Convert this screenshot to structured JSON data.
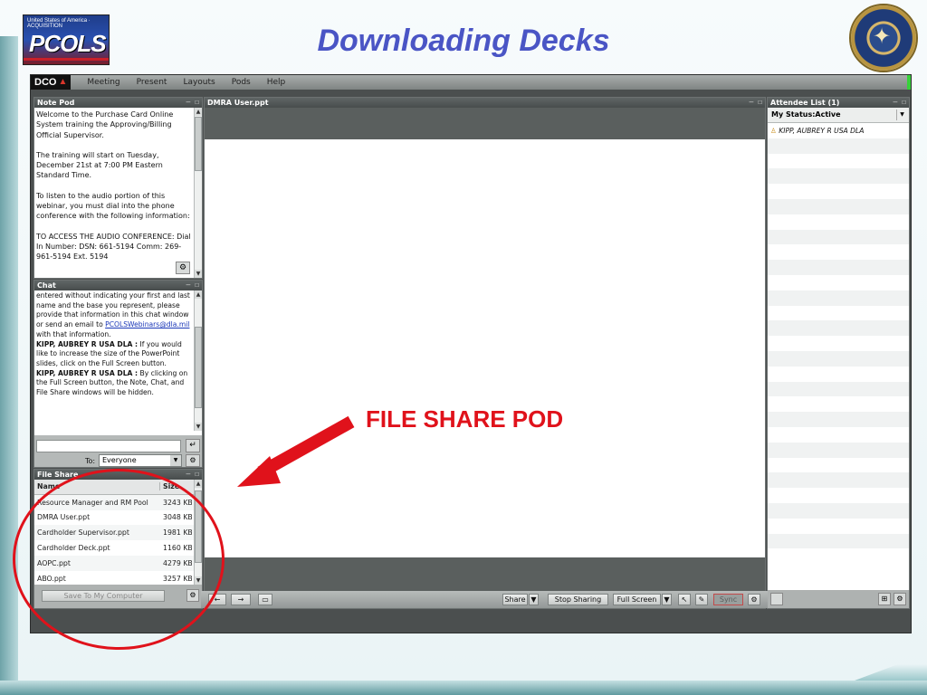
{
  "slide": {
    "title": "Downloading Decks",
    "logo_text": "PCOLS",
    "logo_small": "United States of America · ACQUISITION",
    "callout": "FILE SHARE POD",
    "seal_icon": "dod-seal-icon"
  },
  "app": {
    "brand": "DCO",
    "menu": [
      "Meeting",
      "Present",
      "Layouts",
      "Pods",
      "Help"
    ],
    "pods": {
      "note": {
        "title": "Note Pod",
        "paragraphs": [
          "Welcome to the Purchase Card Online System training the Approving/Billing Official Supervisor.",
          "The training will start on Tuesday, December 21st at 7:00 PM Eastern Standard Time.",
          "To listen to the audio portion of this webinar, you must dial into the phone conference with the following information:",
          "TO ACCESS THE AUDIO CONFERENCE: Dial In Number: DSN: 661-5194 Comm: 269-961-5194 Ext. 5194"
        ]
      },
      "chat": {
        "title": "Chat",
        "lines": [
          {
            "text": "entered without indicating your first and last name and the base you represent, please provide that information in this chat window or send an email to "
          },
          {
            "link": "PCOLSWebinars@dla.mil"
          },
          {
            "text": " with that information."
          },
          {
            "sender": "KIPP, AUBREY R USA DLA :",
            "text": " If you would like to increase the size of the PowerPoint slides, click on the Full Screen button."
          },
          {
            "sender": "KIPP, AUBREY R USA DLA :",
            "text": " By clicking on the Full Screen button, the Note, Chat, and File Share windows will be hidden."
          }
        ],
        "to_label": "To:",
        "to_value": "Everyone"
      },
      "file_share": {
        "title": "File Share",
        "columns": [
          "Name",
          "Size"
        ],
        "rows": [
          {
            "name": "Resource Manager and RM Pool",
            "size": "3243 KB"
          },
          {
            "name": "DMRA User.ppt",
            "size": "3048 KB"
          },
          {
            "name": "Cardholder Supervisor.ppt",
            "size": "1981 KB"
          },
          {
            "name": "Cardholder Deck.ppt",
            "size": "1160 KB"
          },
          {
            "name": "AOPC.ppt",
            "size": "4279 KB"
          },
          {
            "name": "ABO.ppt",
            "size": "3257 KB"
          }
        ],
        "save_button": "Save To My Computer"
      },
      "share": {
        "title": "DMRA User.ppt",
        "buttons": {
          "share": "Share",
          "stop": "Stop Sharing",
          "full": "Full Screen",
          "sync": "Sync"
        }
      },
      "attendees": {
        "title": "Attendee List (1)",
        "status": "My Status:Active",
        "people": [
          "KIPP, AUBREY R USA DLA"
        ]
      }
    }
  }
}
